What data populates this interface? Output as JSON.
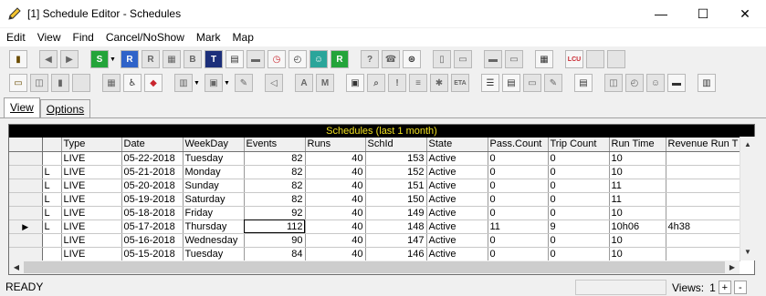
{
  "window": {
    "title": "[1] Schedule Editor - Schedules",
    "minimize": "—",
    "maximize": "☐",
    "close": "✕"
  },
  "menu": [
    "Edit",
    "View",
    "Find",
    "Cancel/NoShow",
    "Mark",
    "Map"
  ],
  "toolbar1_icons": [
    "exit-door-icon",
    "back-arrow-icon",
    "forward-arrow-icon",
    "schedule-s-icon",
    "schedule-r-icon",
    "resource-icon",
    "calendar-icon",
    "badge-icon",
    "table-icon",
    "grid-icon",
    "bus-icon",
    "alarm-clock-icon",
    "clock-icon",
    "people-icon",
    "route-r-icon",
    "help-icon",
    "phone-icon",
    "binoculars-icon",
    "document-icon",
    "note-icon",
    "truck-icon",
    "tape-icon",
    "calculator-icon",
    "lcu-icon",
    "square-icon"
  ],
  "toolbar2_icons": [
    "open-folder-icon",
    "copy-icon",
    "user-icon",
    "grid-icon",
    "edit-icon",
    "wheelchair-icon",
    "eraser-icon",
    "split-icon",
    "pencil-icon",
    "speaker-icon",
    "text-icon",
    "chart-icon",
    "map-icon",
    "search-icon",
    "alert-icon",
    "list-icon",
    "gear-icon",
    "eta-icon",
    "checklist-icon",
    "printer-icon",
    "car-icon",
    "tool-icon",
    "notepad-icon",
    "copy-pages-icon",
    "clock-history-icon",
    "face-icon",
    "monitor-icon",
    "book-icon"
  ],
  "toolbar_labels": {
    "s": "S",
    "r": "R",
    "route_r": "R",
    "lcu": "LCU",
    "eta": "ETA"
  },
  "tabs": [
    "View",
    "Options"
  ],
  "grid": {
    "title": "Schedules (last 1 month)",
    "columns": [
      "",
      "Type",
      "Date",
      "WeekDay",
      "Events",
      "Runs",
      "SchId",
      "State",
      "Pass.Count",
      "Trip Count",
      "Run Time",
      "Revenue Run T"
    ],
    "rows": [
      {
        "indicator": "",
        "lock": "",
        "type": "LIVE",
        "date": "05-22-2018",
        "weekday": "Tuesday",
        "events": "82",
        "runs": "40",
        "schid": "153",
        "state": "Active",
        "pass_count": "0",
        "trip_count": "0",
        "run_time": "10",
        "revenue": ""
      },
      {
        "indicator": "",
        "lock": "L",
        "type": "LIVE",
        "date": "05-21-2018",
        "weekday": "Monday",
        "events": "82",
        "runs": "40",
        "schid": "152",
        "state": "Active",
        "pass_count": "0",
        "trip_count": "0",
        "run_time": "10",
        "revenue": ""
      },
      {
        "indicator": "",
        "lock": "L",
        "type": "LIVE",
        "date": "05-20-2018",
        "weekday": "Sunday",
        "events": "82",
        "runs": "40",
        "schid": "151",
        "state": "Active",
        "pass_count": "0",
        "trip_count": "0",
        "run_time": "11",
        "revenue": ""
      },
      {
        "indicator": "",
        "lock": "L",
        "type": "LIVE",
        "date": "05-19-2018",
        "weekday": "Saturday",
        "events": "82",
        "runs": "40",
        "schid": "150",
        "state": "Active",
        "pass_count": "0",
        "trip_count": "0",
        "run_time": "11",
        "revenue": ""
      },
      {
        "indicator": "",
        "lock": "L",
        "type": "LIVE",
        "date": "05-18-2018",
        "weekday": "Friday",
        "events": "92",
        "runs": "40",
        "schid": "149",
        "state": "Active",
        "pass_count": "0",
        "trip_count": "0",
        "run_time": "10",
        "revenue": ""
      },
      {
        "indicator": "▶",
        "lock": "L",
        "type": "LIVE",
        "date": "05-17-2018",
        "weekday": "Thursday",
        "events": "112",
        "runs": "40",
        "schid": "148",
        "state": "Active",
        "pass_count": "11",
        "trip_count": "9",
        "run_time": "10h06",
        "revenue": "4h38"
      },
      {
        "indicator": "",
        "lock": "",
        "type": "LIVE",
        "date": "05-16-2018",
        "weekday": "Wednesday",
        "events": "90",
        "runs": "40",
        "schid": "147",
        "state": "Active",
        "pass_count": "0",
        "trip_count": "0",
        "run_time": "10",
        "revenue": ""
      },
      {
        "indicator": "",
        "lock": "",
        "type": "LIVE",
        "date": "05-15-2018",
        "weekday": "Tuesday",
        "events": "84",
        "runs": "40",
        "schid": "146",
        "state": "Active",
        "pass_count": "0",
        "trip_count": "0",
        "run_time": "10",
        "revenue": ""
      }
    ]
  },
  "scroll": {
    "up": "▲",
    "down": "▼",
    "left": "◀",
    "right": "▶"
  },
  "status": {
    "text": "READY",
    "views_label": "Views:",
    "views_value": "1",
    "plus": "+",
    "minus": "-"
  }
}
